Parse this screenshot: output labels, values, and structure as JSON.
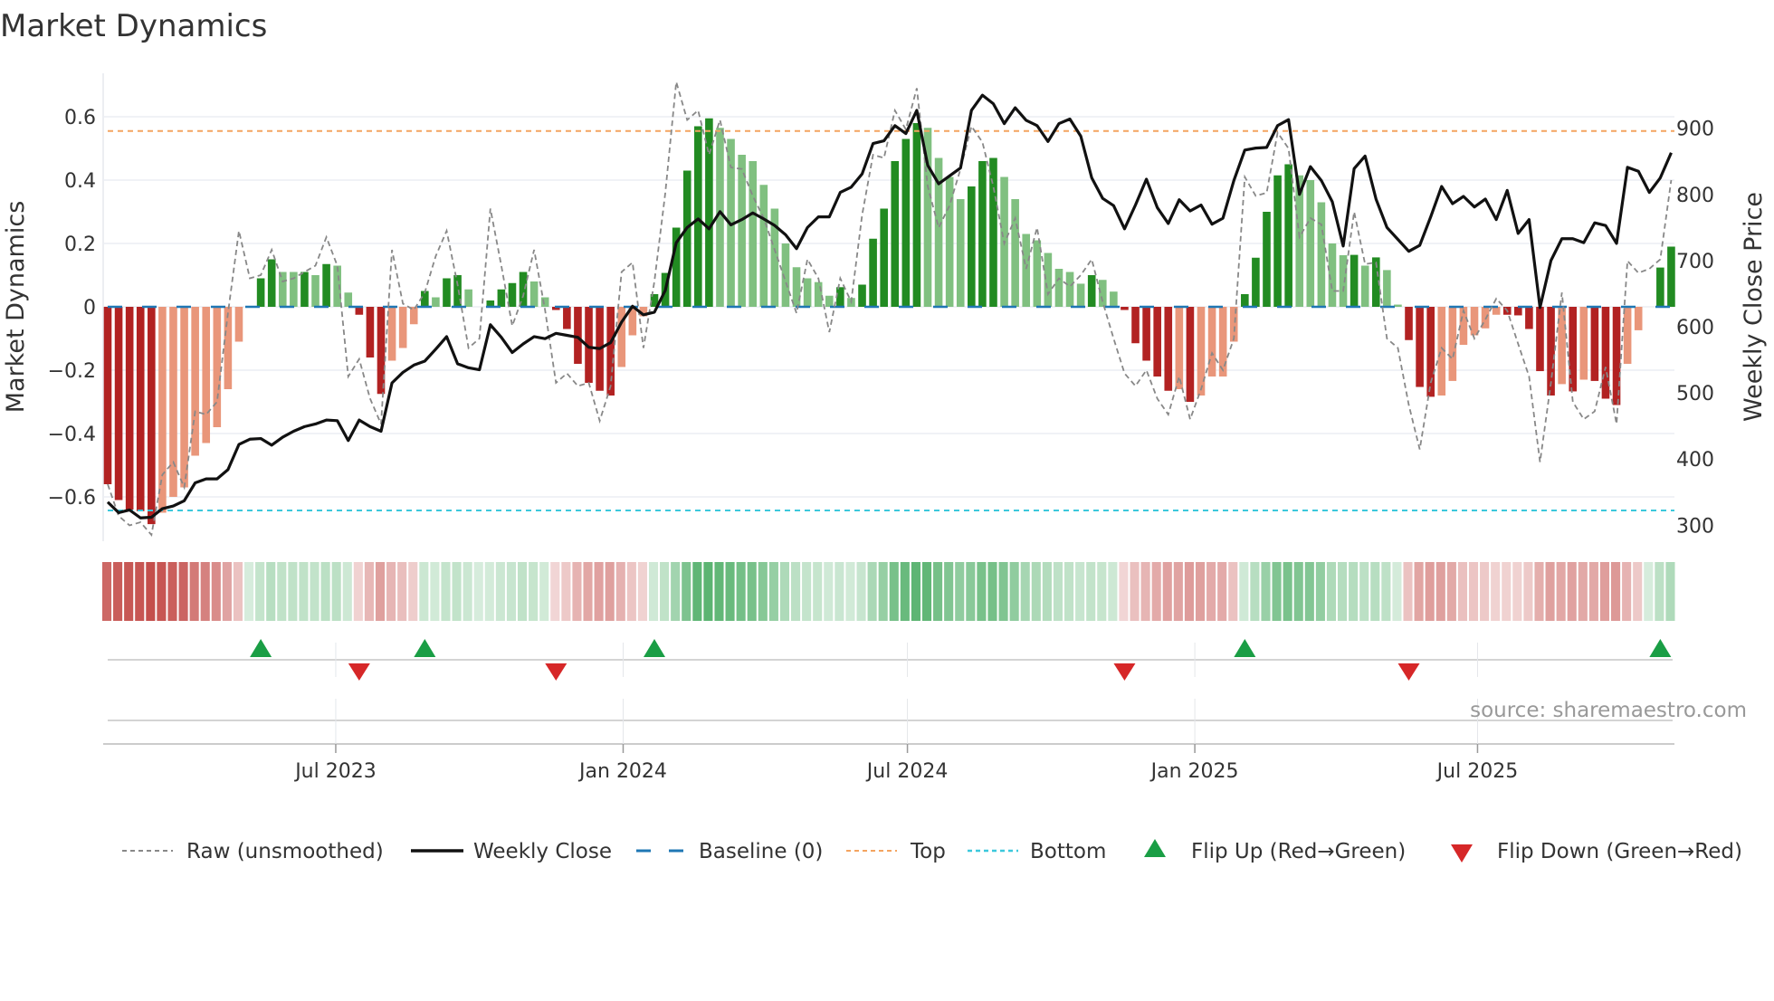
{
  "title": "Market Dynamics",
  "source": "source: sharemaestro.com",
  "chart_data": {
    "type": "bar",
    "title": "Market Dynamics",
    "ylabel": "Market Dynamics",
    "y2label": "Weekly Close Price",
    "ylim": [
      -0.74,
      0.74
    ],
    "y2lim": [
      270,
      980
    ],
    "start_date": "2023-02-05",
    "frequency": "weekly",
    "y_ticks": [
      {
        "v": -0.6,
        "label": "−0.6"
      },
      {
        "v": -0.4,
        "label": "−0.4"
      },
      {
        "v": -0.2,
        "label": "−0.2"
      },
      {
        "v": 0,
        "label": "0"
      },
      {
        "v": 0.2,
        "label": "0.2"
      },
      {
        "v": 0.4,
        "label": "0.4"
      },
      {
        "v": 0.6,
        "label": "0.6"
      }
    ],
    "y2_ticks": [
      {
        "v": 300,
        "label": "300"
      },
      {
        "v": 400,
        "label": "400"
      },
      {
        "v": 500,
        "label": "500"
      },
      {
        "v": 600,
        "label": "600"
      },
      {
        "v": 700,
        "label": "700"
      },
      {
        "v": 800,
        "label": "800"
      },
      {
        "v": 900,
        "label": "900"
      }
    ],
    "x_ticks": [
      {
        "date": "2023-07-01",
        "label": "Jul 2023"
      },
      {
        "date": "2024-01-01",
        "label": "Jan 2024"
      },
      {
        "date": "2024-07-01",
        "label": "Jul 2024"
      },
      {
        "date": "2025-01-01",
        "label": "Jan 2025"
      },
      {
        "date": "2025-07-01",
        "label": "Jul 2025"
      }
    ],
    "top_level": 0.555,
    "bottom_level": -0.643,
    "baseline": 0,
    "dynamics": [
      -0.56,
      -0.61,
      -0.64,
      -0.645,
      -0.686,
      -0.65,
      -0.6,
      -0.57,
      -0.47,
      -0.43,
      -0.38,
      -0.26,
      -0.11,
      0,
      0.09,
      0.15,
      0.11,
      0.11,
      0.11,
      0.1,
      0.135,
      0.13,
      0.045,
      -0.025,
      -0.16,
      -0.275,
      -0.17,
      -0.13,
      -0.055,
      0.05,
      0.03,
      0.09,
      0.1,
      0.055,
      0,
      0.02,
      0.055,
      0.075,
      0.11,
      0.08,
      0.03,
      -0.01,
      -0.07,
      -0.18,
      -0.24,
      -0.265,
      -0.28,
      -0.19,
      -0.09,
      -0.03,
      0.04,
      0.107,
      0.25,
      0.43,
      0.57,
      0.595,
      0.565,
      0.53,
      0.48,
      0.46,
      0.385,
      0.31,
      0.2,
      0.125,
      0.09,
      0.078,
      0.035,
      0.062,
      0.028,
      0.07,
      0.215,
      0.31,
      0.46,
      0.53,
      0.58,
      0.565,
      0.47,
      0.41,
      0.34,
      0.38,
      0.46,
      0.47,
      0.41,
      0.34,
      0.23,
      0.21,
      0.17,
      0.12,
      0.11,
      0.073,
      0.1,
      0.085,
      0.048,
      -0.01,
      -0.115,
      -0.17,
      -0.22,
      -0.265,
      -0.26,
      -0.3,
      -0.28,
      -0.22,
      -0.22,
      -0.11,
      0.04,
      0.155,
      0.3,
      0.415,
      0.45,
      0.415,
      0.4,
      0.33,
      0.2,
      0.163,
      0.164,
      0.13,
      0.156,
      0.116,
      0.007,
      -0.105,
      -0.253,
      -0.284,
      -0.28,
      -0.234,
      -0.12,
      -0.09,
      -0.068,
      -0.025,
      -0.025,
      -0.027,
      -0.07,
      -0.203,
      -0.28,
      -0.244,
      -0.267,
      -0.23,
      -0.234,
      -0.29,
      -0.31,
      -0.18,
      -0.074,
      0,
      0.124,
      0.19
    ],
    "shade": "DDDDDLLLLLLLLLDDLLDLDLLDDDLLLDLDDLLDDDDLLDDDDDDLLLDDDDDDLLLLLLLLLLLDLDDDDDDLLLLDDDLLLLLLLLDLLDDDDDLDLLLLDDDDDLLLLLDLDLLDDDLLLLLLDDDDDLDLDDDLLLDD",
    "raw": [
      -0.56,
      -0.66,
      -0.69,
      -0.68,
      -0.72,
      -0.53,
      -0.49,
      -0.57,
      -0.33,
      -0.34,
      -0.3,
      -0.02,
      0.24,
      0.09,
      0.1,
      0.18,
      0.08,
      0.09,
      0.11,
      0.13,
      0.22,
      0.13,
      -0.22,
      -0.165,
      -0.29,
      -0.37,
      0.18,
      0.01,
      -0.01,
      0.045,
      0.16,
      0.24,
      0.07,
      -0.13,
      -0.1,
      0.31,
      0.13,
      -0.06,
      0.035,
      0.18,
      -0.01,
      -0.24,
      -0.21,
      -0.25,
      -0.24,
      -0.36,
      -0.25,
      0.11,
      0.14,
      -0.13,
      0.08,
      0.36,
      0.71,
      0.59,
      0.62,
      0.48,
      0.59,
      0.44,
      0.435,
      0.35,
      0.28,
      0.18,
      0.08,
      -0.02,
      0.15,
      0.09,
      -0.08,
      0.09,
      0.016,
      0.29,
      0.48,
      0.47,
      0.62,
      0.56,
      0.69,
      0.38,
      0.25,
      0.32,
      0.435,
      0.57,
      0.52,
      0.38,
      0.2,
      0.28,
      0.12,
      0.25,
      0.04,
      0.09,
      0.064,
      0.1,
      0.15,
      0.016,
      -0.1,
      -0.21,
      -0.25,
      -0.2,
      -0.29,
      -0.34,
      -0.22,
      -0.355,
      -0.26,
      -0.146,
      -0.2,
      -0.1,
      0.41,
      0.35,
      0.36,
      0.55,
      0.5,
      0.22,
      0.28,
      0.26,
      0.05,
      0.05,
      0.3,
      0.135,
      0.14,
      -0.1,
      -0.13,
      -0.31,
      -0.45,
      -0.24,
      -0.13,
      -0.165,
      -0.012,
      -0.1,
      -0.04,
      0.026,
      -0.012,
      -0.117,
      -0.22,
      -0.49,
      -0.24,
      0.045,
      -0.3,
      -0.355,
      -0.33,
      -0.19,
      -0.37,
      0.145,
      0.107,
      0.12,
      0.15,
      0.4
    ],
    "weekly_close": [
      335,
      319,
      323,
      311,
      312,
      325,
      329,
      337,
      364,
      370,
      370,
      384,
      422,
      430,
      431,
      421,
      433,
      442,
      449,
      453,
      459,
      458,
      428,
      459,
      449,
      442,
      515,
      531,
      542,
      548,
      566,
      585,
      544,
      538,
      535,
      603,
      584,
      561,
      574,
      585,
      582,
      590,
      587,
      584,
      569,
      567,
      576,
      607,
      631,
      618,
      622,
      655,
      727,
      750,
      763,
      748,
      774,
      754,
      762,
      772,
      763,
      753,
      739,
      718,
      750,
      766,
      766,
      803,
      811,
      831,
      877,
      881,
      904,
      892,
      927,
      844,
      816,
      828,
      840,
      927,
      950,
      937,
      907,
      931,
      912,
      904,
      880,
      907,
      914,
      888,
      825,
      794,
      783,
      748,
      784,
      823,
      780,
      756,
      792,
      775,
      784,
      755,
      764,
      821,
      867,
      870,
      871,
      904,
      913,
      800,
      842,
      821,
      789,
      722,
      839,
      858,
      793,
      750,
      732,
      714,
      723,
      766,
      812,
      786,
      797,
      781,
      793,
      762,
      806,
      741,
      762,
      629,
      700,
      733,
      733,
      727,
      757,
      753,
      726,
      841,
      835,
      803,
      825,
      863
    ],
    "flips": [
      {
        "week": 14,
        "dir": "up"
      },
      {
        "week": 23,
        "dir": "down"
      },
      {
        "week": 29,
        "dir": "up"
      },
      {
        "week": 41,
        "dir": "down"
      },
      {
        "week": 50,
        "dir": "up"
      },
      {
        "week": 93,
        "dir": "down"
      },
      {
        "week": 104,
        "dir": "up"
      },
      {
        "week": 119,
        "dir": "down"
      },
      {
        "week": 142,
        "dir": "up"
      }
    ],
    "colors": {
      "pos_strong": "#228b22",
      "pos_weak": "#80c080",
      "neg_strong": "#b22222",
      "neg_weak": "#e9967a",
      "close": "#111111",
      "raw": "#888888",
      "baseline": "#1f77b4",
      "top": "#f4a460",
      "bottom": "#3cc8dc",
      "flip_up": "#1a9e45",
      "flip_down": "#d62728"
    },
    "legend": {
      "position": "bottom",
      "items": [
        {
          "key": "raw",
          "label": "Raw (unsmoothed)"
        },
        {
          "key": "close",
          "label": "Weekly Close"
        },
        {
          "key": "baseline",
          "label": "Baseline (0)"
        },
        {
          "key": "top",
          "label": "Top"
        },
        {
          "key": "bottom",
          "label": "Bottom"
        },
        {
          "key": "flip_up",
          "label": "Flip Up (Red→Green)"
        },
        {
          "key": "flip_down",
          "label": "Flip Down (Green→Red)"
        }
      ]
    }
  }
}
